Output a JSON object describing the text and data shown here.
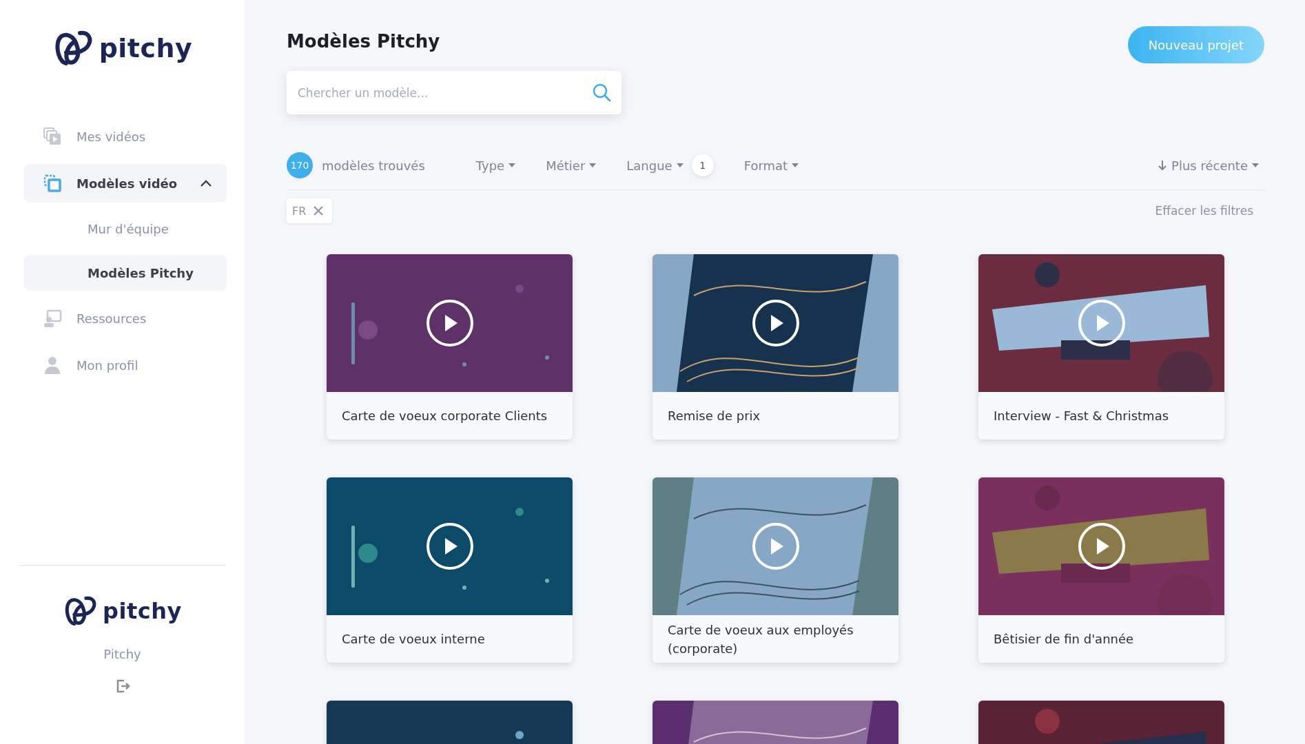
{
  "sidebar": {
    "logo": "pitchy",
    "items": [
      {
        "label": "Mes vidéos",
        "selected": false
      },
      {
        "label": "Modèles vidéo",
        "selected": true,
        "expanded": true,
        "children": [
          {
            "label": "Mur d'équipe",
            "selected": false
          },
          {
            "label": "Modèles Pitchy",
            "selected": true
          }
        ]
      },
      {
        "label": "Ressources",
        "selected": false
      },
      {
        "label": "Mon profil",
        "selected": false
      }
    ],
    "account": {
      "logo": "pitchy",
      "name": "Pitchy"
    }
  },
  "header": {
    "title": "Modèles Pitchy",
    "new_button": "Nouveau projet"
  },
  "search": {
    "placeholder": "Chercher un modèle..."
  },
  "filters": {
    "count": "170",
    "count_label": "modèles trouvés",
    "dropdowns": [
      {
        "label": "Type"
      },
      {
        "label": "Métier"
      },
      {
        "label": "Langue",
        "badge": "1"
      },
      {
        "label": "Format"
      }
    ],
    "sort": "Plus récente",
    "chips": [
      {
        "label": "FR"
      }
    ],
    "clear": "Effacer les filtres"
  },
  "cards": [
    {
      "kind": "template",
      "title": "Carte de voeux corporate Clients"
    },
    {
      "kind": "template",
      "title": "Remise de prix"
    },
    {
      "kind": "template",
      "title": "Interview - Fast & Christmas"
    },
    {
      "kind": "template",
      "title": "Carte de voeux interne"
    },
    {
      "kind": "template",
      "title": "Carte de voeux aux employés (corporate)"
    },
    {
      "kind": "template",
      "title": "Bêtisier de fin d'année"
    },
    {
      "kind": "picture"
    },
    {
      "kind": "picture"
    },
    {
      "kind": "picture"
    }
  ]
}
